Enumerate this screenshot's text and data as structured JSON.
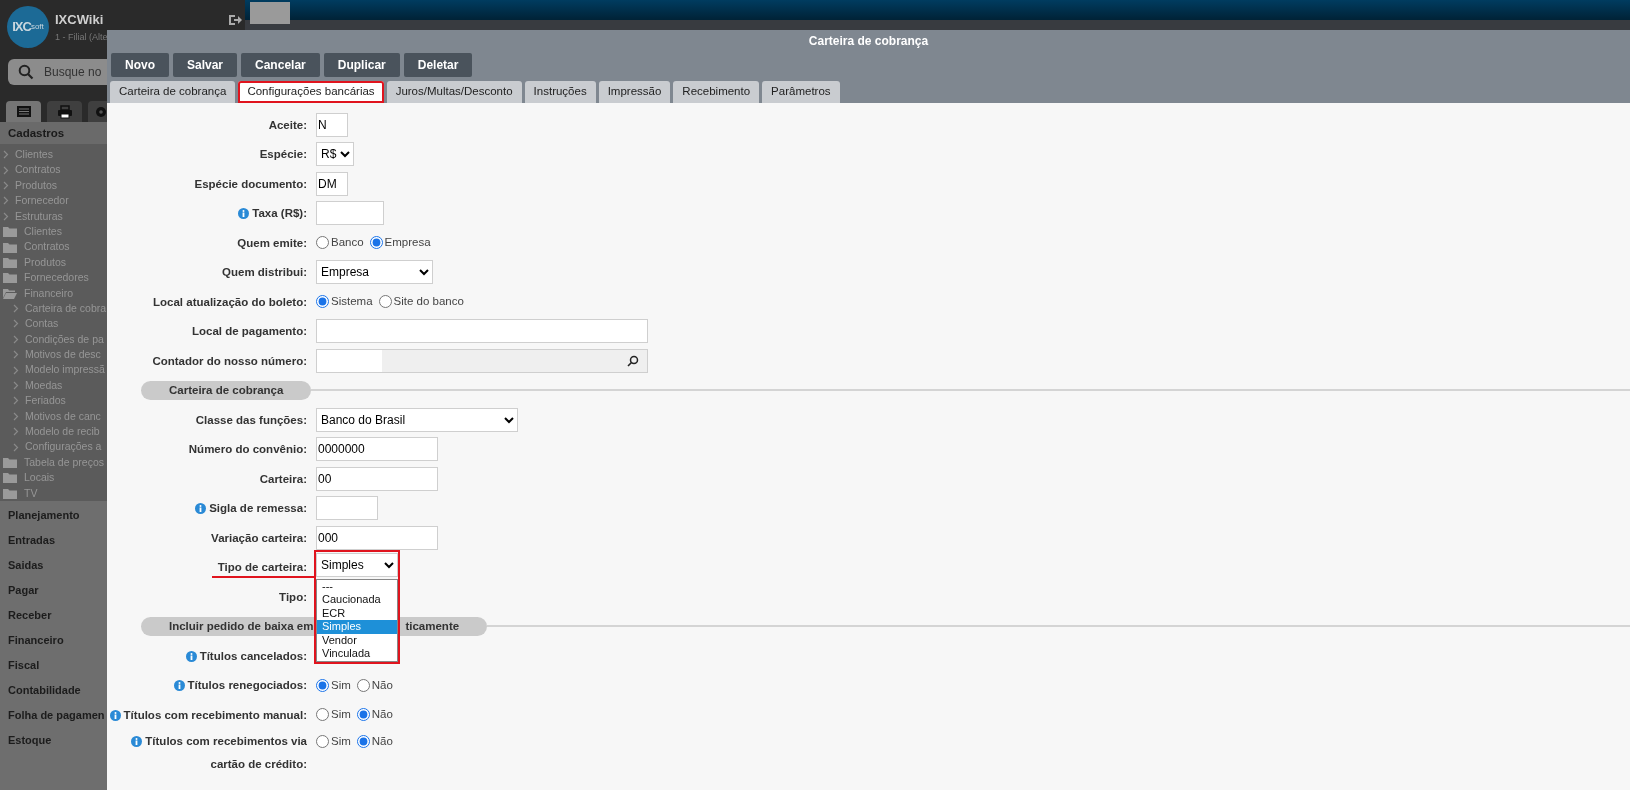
{
  "sidebar": {
    "logo_text": "IXC",
    "logo_suffix": "soft",
    "app_name": "IXCWiki",
    "branch": "1 - Filial (Alte",
    "search_placeholder": "Busque no",
    "tabs": [
      {
        "kind": "list",
        "selected": true
      },
      {
        "kind": "print",
        "selected": false
      },
      {
        "kind": "settings",
        "selected": false
      }
    ],
    "section_title": "Cadastros",
    "tree": [
      {
        "kind": "link",
        "label": "Clientes"
      },
      {
        "kind": "link",
        "label": "Contratos"
      },
      {
        "kind": "link",
        "label": "Produtos"
      },
      {
        "kind": "link",
        "label": "Fornecedor"
      },
      {
        "kind": "link",
        "label": "Estruturas"
      },
      {
        "kind": "folder",
        "label": "Clientes",
        "expanded": false
      },
      {
        "kind": "folder",
        "label": "Contratos",
        "expanded": false
      },
      {
        "kind": "folder",
        "label": "Produtos",
        "expanded": false
      },
      {
        "kind": "folder",
        "label": "Fornecedores",
        "expanded": false
      },
      {
        "kind": "folder",
        "label": "Financeiro",
        "expanded": true,
        "children": [
          {
            "kind": "link",
            "label": "Carteira de cobra"
          },
          {
            "kind": "link",
            "label": "Contas"
          },
          {
            "kind": "link",
            "label": "Condições de pa"
          },
          {
            "kind": "link",
            "label": "Motivos de desc"
          },
          {
            "kind": "link",
            "label": "Modelo impressã"
          },
          {
            "kind": "link",
            "label": "Moedas"
          },
          {
            "kind": "link",
            "label": "Feriados"
          },
          {
            "kind": "link",
            "label": "Motivos de canc"
          },
          {
            "kind": "link",
            "label": "Modelo de recib"
          },
          {
            "kind": "link",
            "label": "Configurações a"
          }
        ]
      },
      {
        "kind": "folder",
        "label": "Tabela de preços",
        "expanded": false
      },
      {
        "kind": "folder",
        "label": "Locais",
        "expanded": false
      },
      {
        "kind": "folder",
        "label": "TV",
        "expanded": false
      }
    ],
    "menu": [
      "Planejamento",
      "Entradas",
      "Saidas",
      "Pagar",
      "Receber",
      "Financeiro",
      "Fiscal",
      "Contabilidade",
      "Folha de pagamen",
      "Estoque"
    ]
  },
  "modal": {
    "title": "Carteira de cobrança",
    "buttons": [
      "Novo",
      "Salvar",
      "Cancelar",
      "Duplicar",
      "Deletar"
    ],
    "tabs": [
      {
        "label": "Carteira de cobrança",
        "selected": false,
        "highlighted": false
      },
      {
        "label": "Configurações bancárias",
        "selected": true,
        "highlighted": true
      },
      {
        "label": "Juros/Multas/Desconto",
        "selected": false,
        "highlighted": false
      },
      {
        "label": "Instruções",
        "selected": false,
        "highlighted": false
      },
      {
        "label": "Impressão",
        "selected": false,
        "highlighted": false
      },
      {
        "label": "Recebimento",
        "selected": false,
        "highlighted": false
      },
      {
        "label": "Parâmetros",
        "selected": false,
        "highlighted": false
      }
    ],
    "rows": [
      {
        "kind": "text",
        "label": "Aceite:",
        "value": "N"
      },
      {
        "kind": "select",
        "label": "Espécie:",
        "value": "R$"
      },
      {
        "kind": "text",
        "label": "Espécie documento:",
        "value": "DM"
      },
      {
        "kind": "text",
        "label": "Taxa (R$):",
        "info": true
      },
      {
        "kind": "radio",
        "label": "Quem emite:",
        "options": [
          {
            "label": "Banco",
            "selected": false
          },
          {
            "label": "Empresa",
            "selected": true
          }
        ]
      },
      {
        "kind": "select",
        "label": "Quem distribui:",
        "value": "Empresa"
      },
      {
        "kind": "radio",
        "label": "Local atualização do boleto:",
        "options": [
          {
            "label": "Sistema",
            "selected": true
          },
          {
            "label": "Site do banco",
            "selected": false
          }
        ]
      },
      {
        "kind": "text",
        "label": "Local de pagamento:"
      },
      {
        "kind": "lookup",
        "label": "Contador do nosso número:"
      },
      {
        "kind": "section",
        "title_parts": [
          "Carteira de cobrança"
        ]
      },
      {
        "kind": "select",
        "label": "Classe das funções:",
        "value": "Banco do Brasil"
      },
      {
        "kind": "text",
        "label": "Número do convênio:",
        "value": "0000000"
      },
      {
        "kind": "text",
        "label": "Carteira:",
        "value": "00"
      },
      {
        "kind": "text",
        "label": "Sigla de remessa:",
        "info": true
      },
      {
        "kind": "text",
        "label": "Variação carteira:",
        "value": "000"
      },
      {
        "kind": "select",
        "label": "Tipo de carteira:",
        "value": "Simples",
        "expanded": true,
        "highlighted": true,
        "underlined": true,
        "options": [
          {
            "label": "---",
            "selected": false
          },
          {
            "label": "Caucionada",
            "selected": false
          },
          {
            "label": "ECR",
            "selected": false
          },
          {
            "label": "Simples",
            "selected": true
          },
          {
            "label": "Vendor",
            "selected": false
          },
          {
            "label": "Vinculada",
            "selected": false
          }
        ]
      },
      {
        "kind": "label",
        "label": "Tipo:"
      },
      {
        "kind": "section",
        "title_parts": [
          "Incluir pedido de baixa em",
          "ticamente"
        ]
      },
      {
        "kind": "label",
        "label": "Títulos cancelados:",
        "info": true
      },
      {
        "kind": "radio",
        "label": "Títulos renegociados:",
        "info": true,
        "options": [
          {
            "label": "Sim",
            "selected": true
          },
          {
            "label": "Não",
            "selected": false
          }
        ]
      },
      {
        "kind": "radio",
        "label": "Títulos com recebimento manual:",
        "info": true,
        "options": [
          {
            "label": "Sim",
            "selected": false
          },
          {
            "label": "Não",
            "selected": true
          }
        ]
      },
      {
        "kind": "radio",
        "label": "Títulos com recebimentos via\ncartão de crédito:",
        "info": true,
        "options": [
          {
            "label": "Sim",
            "selected": false
          },
          {
            "label": "Não",
            "selected": true
          }
        ]
      }
    ]
  }
}
